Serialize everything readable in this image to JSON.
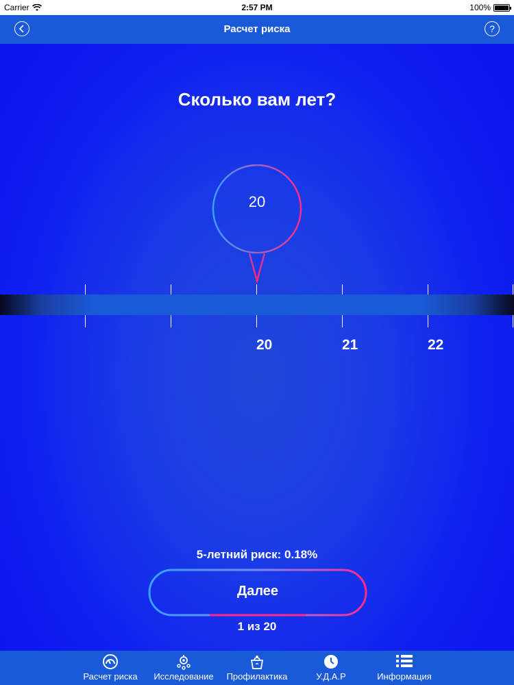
{
  "status_bar": {
    "carrier": "Carrier",
    "time": "2:57 PM",
    "battery": "100%"
  },
  "nav": {
    "title": "Расчет риска",
    "back_icon": "chevron-left-icon",
    "help_icon": "question-icon",
    "help_glyph": "?",
    "back_glyph": "<"
  },
  "question": "Сколько вам лет?",
  "selector": {
    "current_value": "20",
    "ticks": [
      "20",
      "21",
      "22"
    ]
  },
  "risk": {
    "label": "5-летний риск: 0.18%"
  },
  "next_button": {
    "label": "Далее"
  },
  "pager": "1 из 20",
  "tabs": [
    {
      "label": "Расчет риска",
      "icon": "gauge-icon"
    },
    {
      "label": "Исследование",
      "icon": "research-icon"
    },
    {
      "label": "Профилактика",
      "icon": "bag-icon"
    },
    {
      "label": "У.Д.А.Р",
      "icon": "clock-icon"
    },
    {
      "label": "Информация",
      "icon": "list-icon"
    }
  ],
  "colors": {
    "background": "#1a3be6",
    "nav": "#1a5ad8",
    "accent_pink": "#ff2a8a",
    "accent_blue": "#3aa0ff"
  }
}
